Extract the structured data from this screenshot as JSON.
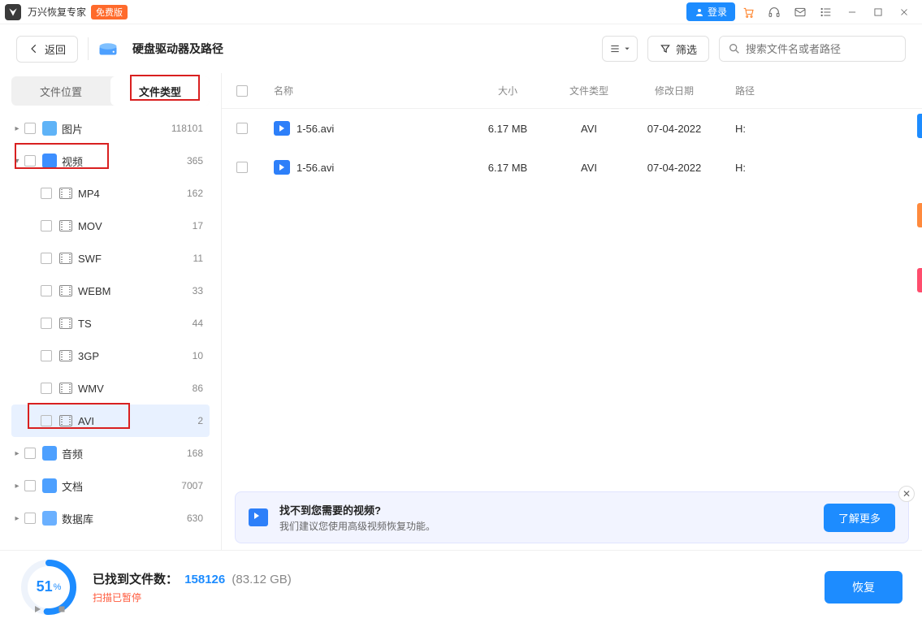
{
  "titlebar": {
    "app_name": "万兴恢复专家",
    "free_badge": "免费版",
    "login": "登录"
  },
  "toolbar": {
    "back": "返回",
    "drive_title": "硬盘驱动器及路径",
    "filter": "筛选",
    "search_placeholder": "搜索文件名或者路径"
  },
  "sidebar": {
    "tabs": {
      "location": "文件位置",
      "type": "文件类型"
    },
    "items": [
      {
        "label": "图片",
        "count": "118101"
      },
      {
        "label": "视频",
        "count": "365"
      },
      {
        "label": "音频",
        "count": "168"
      },
      {
        "label": "文档",
        "count": "7007"
      },
      {
        "label": "数据库",
        "count": "630"
      }
    ],
    "video_children": [
      {
        "label": "MP4",
        "count": "162"
      },
      {
        "label": "MOV",
        "count": "17"
      },
      {
        "label": "SWF",
        "count": "11"
      },
      {
        "label": "WEBM",
        "count": "33"
      },
      {
        "label": "TS",
        "count": "44"
      },
      {
        "label": "3GP",
        "count": "10"
      },
      {
        "label": "WMV",
        "count": "86"
      },
      {
        "label": "AVI",
        "count": "2"
      }
    ]
  },
  "table": {
    "headers": {
      "name": "名称",
      "size": "大小",
      "type": "文件类型",
      "date": "修改日期",
      "path": "路径"
    },
    "rows": [
      {
        "name": "1-56.avi",
        "size": "6.17 MB",
        "type": "AVI",
        "date": "07-04-2022",
        "path": "H:"
      },
      {
        "name": "1-56.avi",
        "size": "6.17 MB",
        "type": "AVI",
        "date": "07-04-2022",
        "path": "H:"
      }
    ]
  },
  "tip": {
    "title": "找不到您需要的视频?",
    "sub": "我们建议您使用高级视频恢复功能。",
    "btn": "了解更多"
  },
  "footer": {
    "percent": "51",
    "found_label": "已找到文件数：",
    "found_count": "158126",
    "found_size": "(83.12 GB)",
    "scan_status": "扫描已暂停",
    "recover": "恢复"
  }
}
